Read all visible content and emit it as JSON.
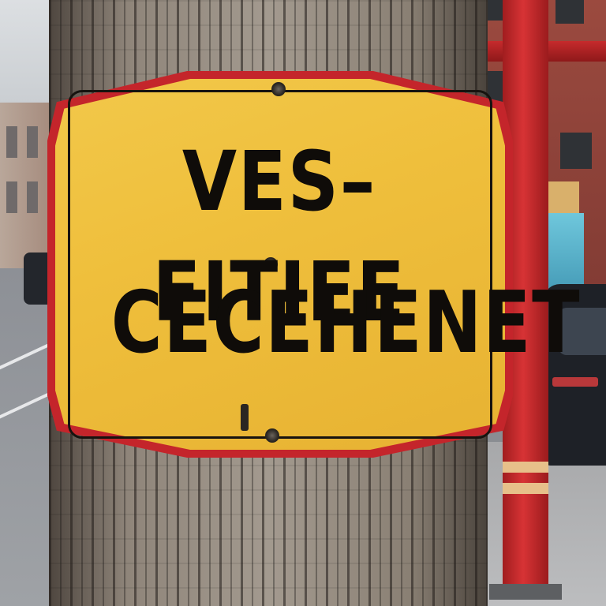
{
  "image": {
    "sign": {
      "line1": "VES–FITIEE",
      "line2": "CECEHENET"
    },
    "colors": {
      "sign_face": "#efbf3c",
      "sign_edge": "#c4252b",
      "text": "#0f0c09",
      "pole": "#d73335"
    }
  }
}
